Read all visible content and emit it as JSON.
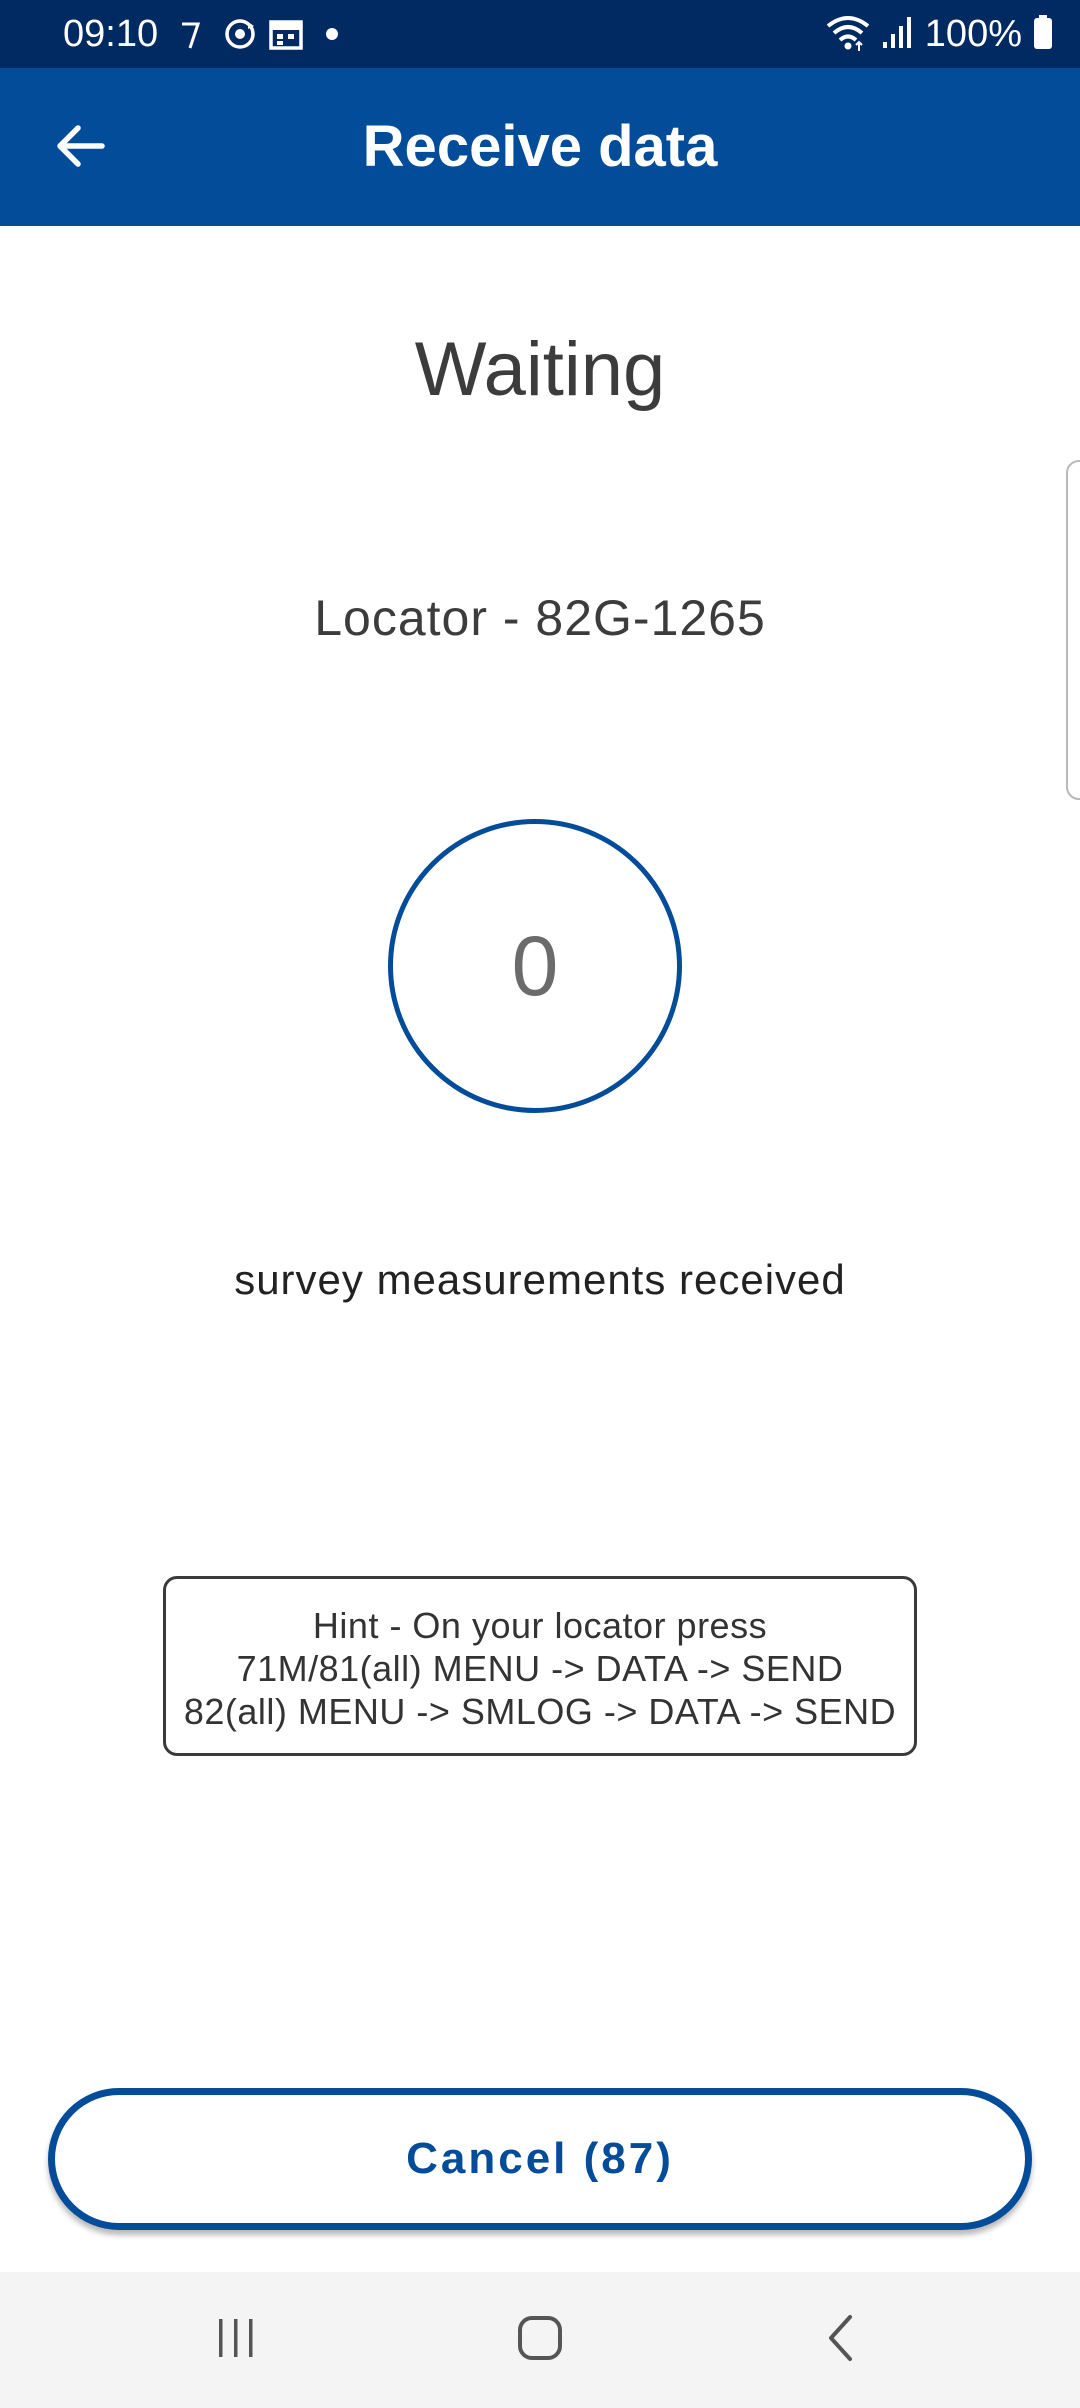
{
  "status_bar": {
    "time": "09:10",
    "battery_text": "100%",
    "notification_icons": [
      "notification-icon",
      "sync-icon",
      "calendar-icon",
      "dot-icon"
    ],
    "system_icons": [
      "wifi-icon",
      "signal-icon",
      "battery-icon"
    ]
  },
  "app_bar": {
    "title": "Receive data",
    "back_icon": "arrow-left-icon"
  },
  "content": {
    "status_text": "Waiting",
    "device_name": "Locator - 82G-1265",
    "counter_value": "0",
    "counter_label": "survey measurements received",
    "hint_lines": [
      "Hint - On your locator press",
      "71M/81(all) MENU -> DATA -> SEND",
      "82(all) MENU -> SMLOG -> DATA -> SEND"
    ]
  },
  "actions": {
    "cancel_label": "Cancel (87)"
  },
  "nav_bar": {
    "icons": [
      "recent-apps-icon",
      "home-icon",
      "back-icon"
    ]
  },
  "colors": {
    "status_bar": "#012a63",
    "app_bar": "#024c9a",
    "accent": "#024c9a",
    "nav_bar": "#f4f4f4"
  }
}
